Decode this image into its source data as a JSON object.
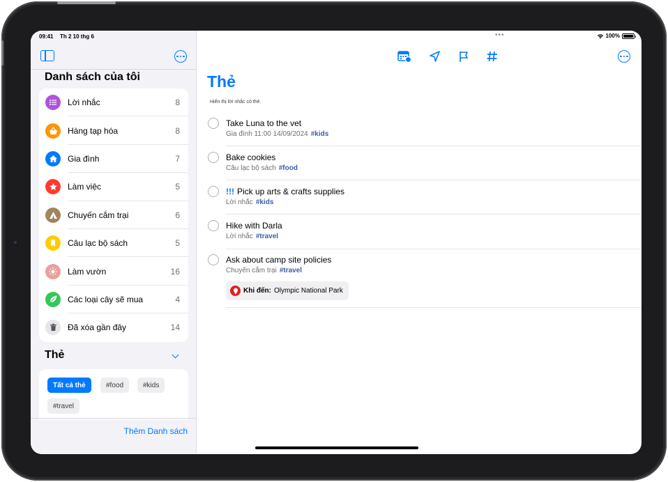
{
  "status": {
    "time": "09:41",
    "date": "Th 2 10 thg 6",
    "battery": "100%"
  },
  "sidebar": {
    "heading": "Danh sách của tôi",
    "lists": [
      {
        "label": "Lời nhắc",
        "count": "8",
        "icon": "list-bullet-icon",
        "color": "#af52de"
      },
      {
        "label": "Hàng tạp hóa",
        "count": "8",
        "icon": "basket-icon",
        "color": "#ff9500"
      },
      {
        "label": "Gia đình",
        "count": "7",
        "icon": "house-icon",
        "color": "#007aff"
      },
      {
        "label": "Làm việc",
        "count": "5",
        "icon": "star-icon",
        "color": "#ff3b30"
      },
      {
        "label": "Chuyến cắm trại",
        "count": "6",
        "icon": "tent-icon",
        "color": "#a2845e"
      },
      {
        "label": "Câu lạc bộ sách",
        "count": "5",
        "icon": "bookmark-icon",
        "color": "#ffcc00"
      },
      {
        "label": "Làm vườn",
        "count": "16",
        "icon": "sun-icon",
        "color": "#e8a09a"
      },
      {
        "label": "Các loại cây sẽ mua",
        "count": "4",
        "icon": "leaf-icon",
        "color": "#34c759"
      },
      {
        "label": "Đã xóa gần đây",
        "count": "14",
        "icon": "trash-icon",
        "color": "#e5e5ea"
      }
    ],
    "tags_heading": "Thẻ",
    "tags": [
      {
        "label": "Tất cả thẻ",
        "active": true
      },
      {
        "label": "#food",
        "active": false
      },
      {
        "label": "#kids",
        "active": false
      },
      {
        "label": "#travel",
        "active": false
      }
    ],
    "add_list": "Thêm Danh sách"
  },
  "main": {
    "title": "Thẻ",
    "subtitle": "Hiển thị lời nhắc có thẻ.",
    "reminders": [
      {
        "priority": "",
        "title": "Take Luna to the vet",
        "meta": "Gia đình  11:00 14/09/2024",
        "tag": "#kids"
      },
      {
        "priority": "",
        "title": "Bake cookies",
        "meta": "Câu lạc bộ sách",
        "tag": "#food"
      },
      {
        "priority": "!!!",
        "title": "Pick up arts & crafts supplies",
        "meta": "Lời nhắc",
        "tag": "#kids"
      },
      {
        "priority": "",
        "title": "Hike with Darla",
        "meta": "Lời nhắc",
        "tag": "#travel"
      },
      {
        "priority": "",
        "title": "Ask about camp site policies",
        "meta": "Chuyến cắm trại",
        "tag": "#travel"
      }
    ],
    "location": {
      "label": "Khi đến:",
      "value": "Olympic National Park"
    }
  },
  "colors": {
    "accent": "#007aff",
    "tag_text": "#3b5ea8",
    "location_pin": "#e02020"
  }
}
